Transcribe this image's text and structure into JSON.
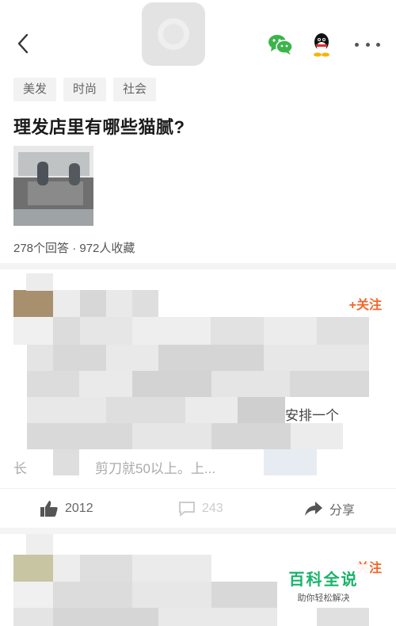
{
  "header": {
    "back_icon": "chevron-left-icon",
    "logo_icon": "app-logo-icon",
    "share_wechat_icon": "wechat-icon",
    "share_qq_icon": "qq-icon",
    "more_icon": "more-dots-icon",
    "wechat_color": "#3bb54a"
  },
  "question": {
    "tags": [
      "美发",
      "时尚",
      "社会"
    ],
    "title": "理发店里有哪些猫腻?",
    "stats": "278个回答 · 972人收藏"
  },
  "answer": {
    "follow_label": "+关注",
    "visible_text_fragments": [
      "安排一个",
      "长",
      "剪刀就50以上。上..."
    ],
    "actions": {
      "like_count": "2012",
      "comment_count": "243",
      "share_label": "分享"
    }
  },
  "second_answer": {
    "follow_label": "关注"
  },
  "watermark": {
    "title": "百科全说",
    "subtitle": "助你轻松解决"
  },
  "colors": {
    "accent": "#f3652b",
    "tag_bg": "#f2f2f2",
    "divider": "#f4f4f4"
  }
}
